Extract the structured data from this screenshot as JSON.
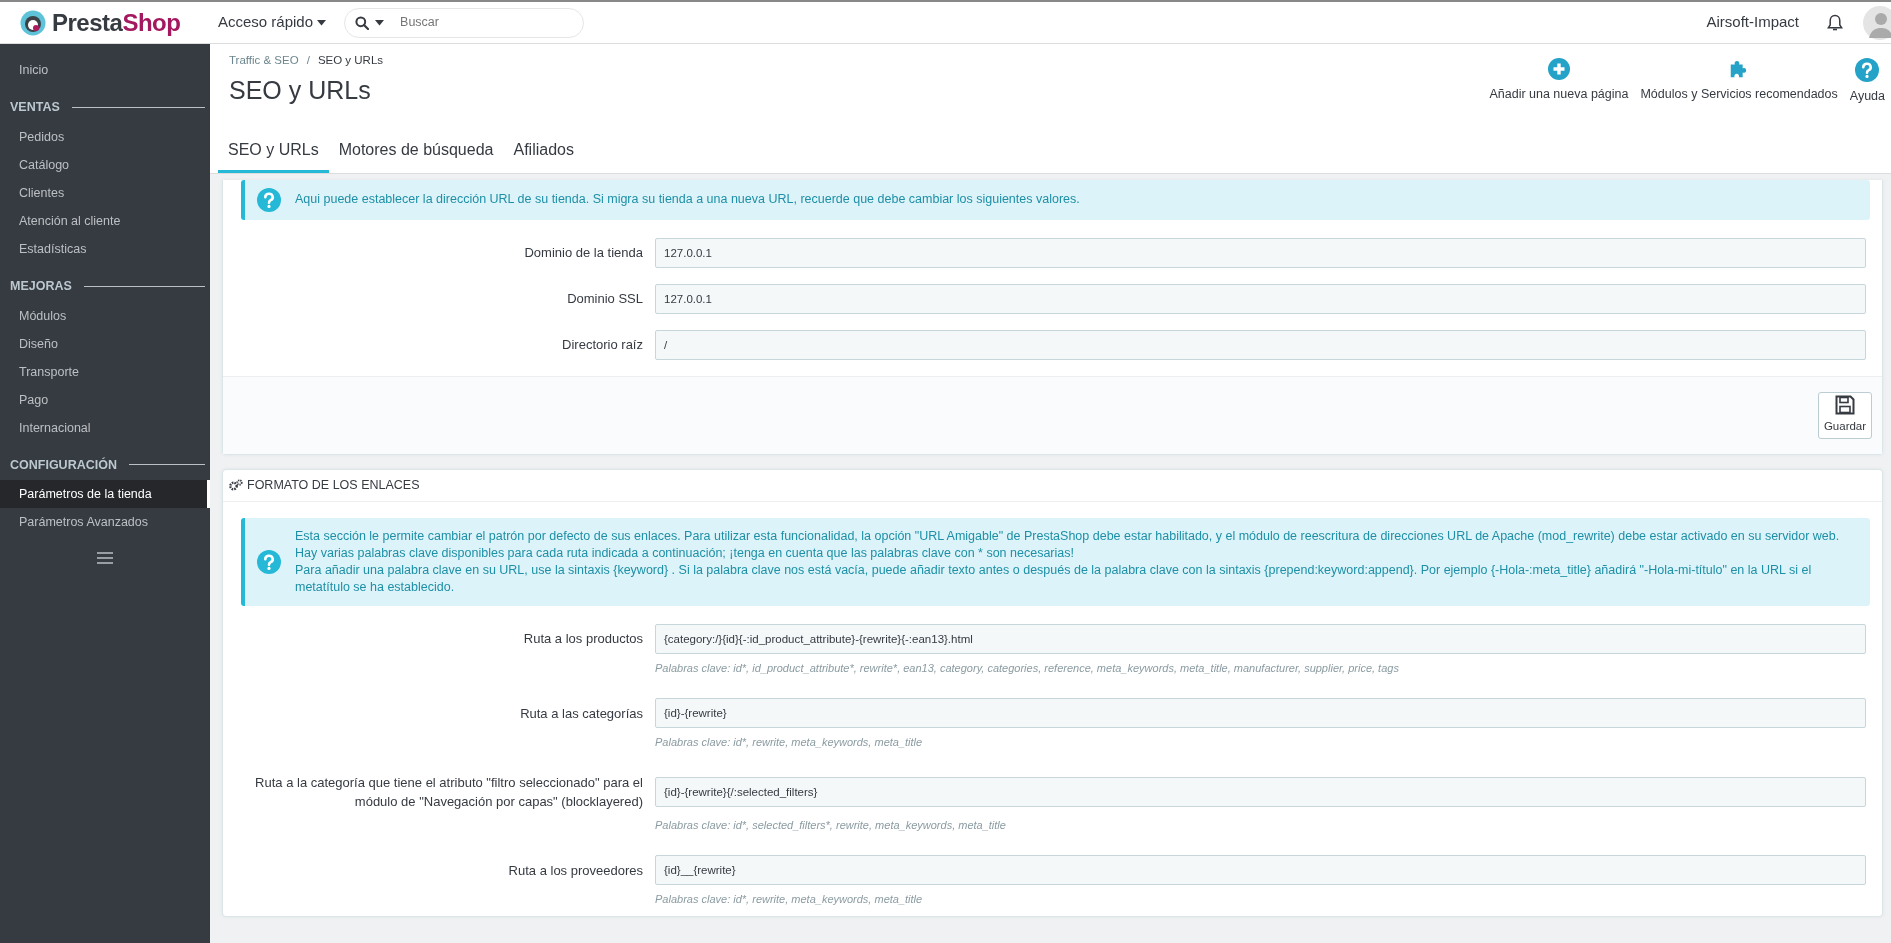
{
  "topbar": {
    "logo_parts": [
      "Presta",
      "Shop"
    ],
    "quick_access": "Acceso rápido",
    "search": {
      "placeholder": "Buscar"
    },
    "shop_name": "Airsoft-Impact"
  },
  "sidebar": {
    "items": [
      {
        "kind": "link",
        "label": "Inicio",
        "selected": false
      },
      {
        "kind": "section",
        "label": "VENTAS"
      },
      {
        "kind": "link",
        "label": "Pedidos",
        "selected": false
      },
      {
        "kind": "link",
        "label": "Catálogo",
        "selected": false
      },
      {
        "kind": "link",
        "label": "Clientes",
        "selected": false
      },
      {
        "kind": "link",
        "label": "Atención al cliente",
        "selected": false
      },
      {
        "kind": "link",
        "label": "Estadísticas",
        "selected": false
      },
      {
        "kind": "section",
        "label": "MEJORAS"
      },
      {
        "kind": "link",
        "label": "Módulos",
        "selected": false
      },
      {
        "kind": "link",
        "label": "Diseño",
        "selected": false
      },
      {
        "kind": "link",
        "label": "Transporte",
        "selected": false
      },
      {
        "kind": "link",
        "label": "Pago",
        "selected": false
      },
      {
        "kind": "link",
        "label": "Internacional",
        "selected": false
      },
      {
        "kind": "section",
        "label": "CONFIGURACIÓN"
      },
      {
        "kind": "link",
        "label": "Parámetros de la tienda",
        "selected": true
      },
      {
        "kind": "link",
        "label": "Parámetros Avanzados",
        "selected": false
      }
    ]
  },
  "header": {
    "breadcrumb": [
      "Traffic & SEO",
      "SEO y URLs"
    ],
    "breadcrumb_separator": "/",
    "title": "SEO y URLs",
    "toolbar": [
      {
        "kind": "add",
        "label": "Añadir una nueva página"
      },
      {
        "kind": "modules",
        "label": "Módulos y Servicios recomendados"
      },
      {
        "kind": "help",
        "label": "Ayuda"
      }
    ]
  },
  "tabs": [
    {
      "label": "SEO y URLs",
      "selected": true
    },
    {
      "label": "Motores de búsqueda",
      "selected": false
    },
    {
      "label": "Afiliados",
      "selected": false
    }
  ],
  "shop_url_panel": {
    "alert": "Aqui puede establecer la dirección URL de su tienda. Si migra su tienda a una nueva URL, recuerde que debe cambiar los siguientes valores.",
    "fields": [
      {
        "label": "Dominio de la tienda",
        "value": "127.0.0.1"
      },
      {
        "label": "Dominio SSL",
        "value": "127.0.0.1"
      },
      {
        "label": "Directorio raíz",
        "value": "/"
      }
    ],
    "save_button": "Guardar"
  },
  "links_panel": {
    "heading": "FORMATO DE LOS ENLACES",
    "alert_lines": [
      "Esta sección le permite cambiar el patrón por defecto de sus enlaces. Para utilizar esta funcionalidad, la opción \"URL Amigable\" de PrestaShop debe estar habilitado, y el módulo de reescritura de direcciones URL de Apache (mod_rewrite) debe estar activado en su servidor web.",
      "Hay varias palabras clave disponibles para cada ruta indicada a continuación; ¡tenga en cuenta que las palabras clave con * son necesarias!",
      "Para añadir una palabra clave en su URL, use la sintaxis {keyword} . Si la palabra clave nos está vacía, puede añadir texto antes o después de la palabra clave con la sintaxis {prepend:keyword:append}. Por ejemplo {-Hola-:meta_title} añadirá \"-Hola-mi-título\" en la URL si el metatítulo se ha establecido."
    ],
    "routes": [
      {
        "label": "Ruta a los productos",
        "value": "{category:/}{id}{-:id_product_attribute}-{rewrite}{-:ean13}.html",
        "hint": "Palabras clave: id*, id_product_attribute*, rewrite*, ean13, category, categories, reference, meta_keywords, meta_title, manufacturer, supplier, price, tags"
      },
      {
        "label": "Ruta a las categorías",
        "value": "{id}-{rewrite}",
        "hint": "Palabras clave: id*, rewrite, meta_keywords, meta_title"
      },
      {
        "label": "Ruta a la categoría que tiene el atributo \"filtro seleccionado\" para el módulo de \"Navegación por capas\" (blocklayered)",
        "value": "{id}-{rewrite}{/:selected_filters}",
        "hint": "Palabras clave: id*, selected_filters*, rewrite, meta_keywords, meta_title"
      },
      {
        "label": "Ruta a los proveedores",
        "value": "{id}__{rewrite}",
        "hint": "Palabras clave: id*, rewrite, meta_keywords, meta_title"
      }
    ]
  }
}
